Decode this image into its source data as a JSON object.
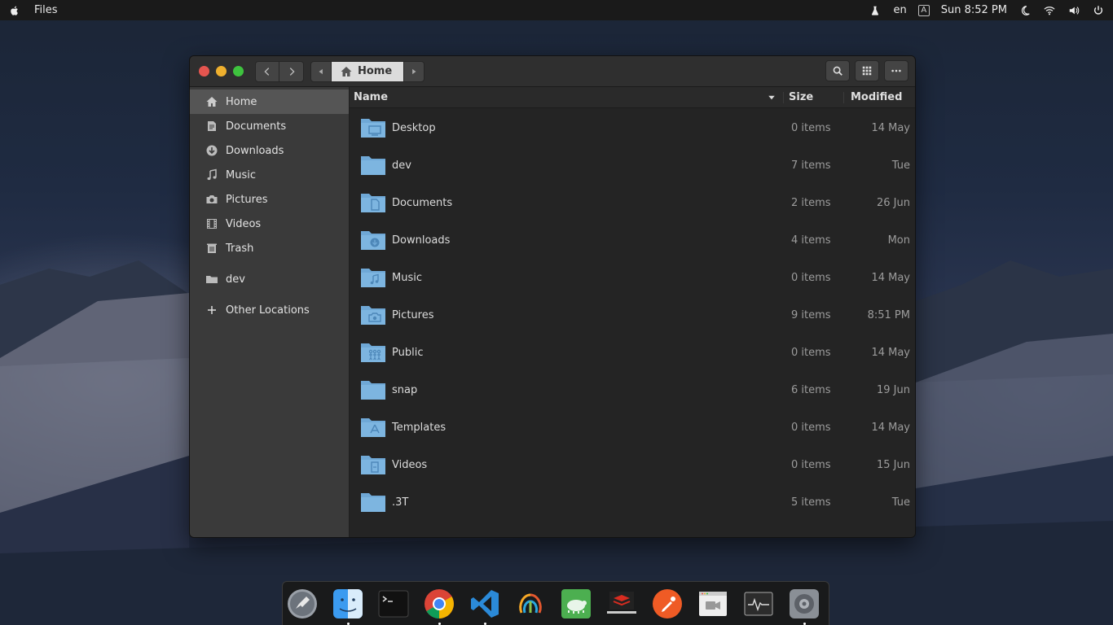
{
  "topbar": {
    "app_name": "Files",
    "language": "en",
    "input_indicator": "A",
    "day": "Sun",
    "time": "8:52 PM"
  },
  "window": {
    "path": {
      "current": "Home"
    },
    "columns": {
      "name": "Name",
      "size": "Size",
      "modified": "Modified"
    }
  },
  "sidebar": {
    "items": [
      {
        "label": "Home",
        "icon": "home-icon",
        "active": true
      },
      {
        "label": "Documents",
        "icon": "documents-icon"
      },
      {
        "label": "Downloads",
        "icon": "download-icon"
      },
      {
        "label": "Music",
        "icon": "music-icon"
      },
      {
        "label": "Pictures",
        "icon": "camera-icon"
      },
      {
        "label": "Videos",
        "icon": "film-icon"
      },
      {
        "label": "Trash",
        "icon": "trash-icon"
      }
    ],
    "bookmarks": [
      {
        "label": "dev",
        "icon": "folder-icon"
      }
    ],
    "other": {
      "label": "Other Locations",
      "icon": "plus-icon"
    }
  },
  "files": [
    {
      "name": "Desktop",
      "size": "0 items",
      "modified": "14 May",
      "emblem": "desktop"
    },
    {
      "name": "dev",
      "size": "7 items",
      "modified": "Tue",
      "emblem": "none"
    },
    {
      "name": "Documents",
      "size": "2 items",
      "modified": "26 Jun",
      "emblem": "document"
    },
    {
      "name": "Downloads",
      "size": "4 items",
      "modified": "Mon",
      "emblem": "download"
    },
    {
      "name": "Music",
      "size": "0 items",
      "modified": "14 May",
      "emblem": "music"
    },
    {
      "name": "Pictures",
      "size": "9 items",
      "modified": "8:51 PM",
      "emblem": "camera"
    },
    {
      "name": "Public",
      "size": "0 items",
      "modified": "14 May",
      "emblem": "people"
    },
    {
      "name": "snap",
      "size": "6 items",
      "modified": "19 Jun",
      "emblem": "none"
    },
    {
      "name": "Templates",
      "size": "0 items",
      "modified": "14 May",
      "emblem": "template"
    },
    {
      "name": "Videos",
      "size": "0 items",
      "modified": "15 Jun",
      "emblem": "film"
    },
    {
      "name": ".3T",
      "size": "5 items",
      "modified": "Tue",
      "emblem": "none"
    }
  ],
  "dock": {
    "apps": [
      {
        "name": "launchpad-icon",
        "running": false
      },
      {
        "name": "finder-icon",
        "running": true
      },
      {
        "name": "terminal-icon",
        "running": false
      },
      {
        "name": "chrome-icon",
        "running": true
      },
      {
        "name": "vscode-icon",
        "running": true
      },
      {
        "name": "navicat-icon",
        "running": false
      },
      {
        "name": "turtle-app-icon",
        "running": false
      },
      {
        "name": "redis-desktop-icon",
        "running": false
      },
      {
        "name": "postman-icon",
        "running": false
      },
      {
        "name": "screen-recorder-icon",
        "running": false
      },
      {
        "name": "system-monitor-icon",
        "running": false
      },
      {
        "name": "system-preferences-icon",
        "running": true
      }
    ]
  },
  "colors": {
    "traffic_close": "#e5554f",
    "traffic_minimize": "#efb02e",
    "traffic_maximize": "#3ec33e",
    "folder": "#6fa8d6"
  }
}
